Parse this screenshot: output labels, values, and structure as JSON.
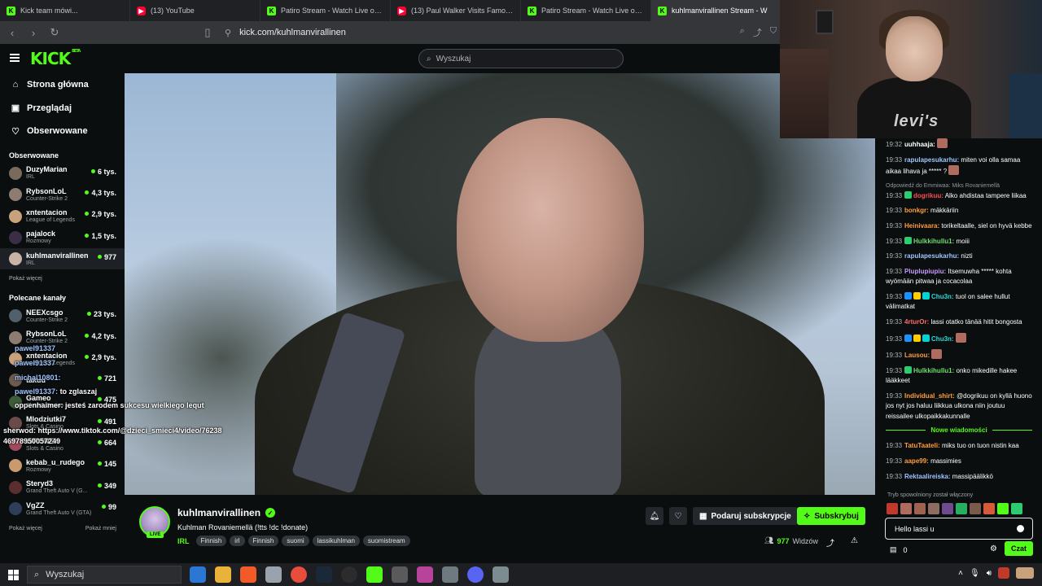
{
  "tabs": [
    {
      "icon": "kick-favicon",
      "fav": "K",
      "label": "Kick team mówi..."
    },
    {
      "icon": "youtube-favicon",
      "fav": "▶",
      "label": "(13) YouTube"
    },
    {
      "icon": "kick-favicon",
      "fav": "K",
      "label": "Patiro Stream - Watch Live on Kick"
    },
    {
      "icon": "youtube-favicon",
      "fav": "▶",
      "label": "(13) Paul Walker Visits Famous Nissan"
    },
    {
      "icon": "kick-favicon",
      "fav": "K",
      "label": "Patiro Stream - Watch Live on Kick"
    },
    {
      "icon": "kick-favicon",
      "fav": "K",
      "label": "kuhlmanvirallinen Stream - W"
    }
  ],
  "address": {
    "url": "kick.com/kuhlmanvirallinen"
  },
  "header": {
    "logo": "KICK",
    "beta": "BETA",
    "search_placeholder": "Wyszukaj"
  },
  "sidebar": {
    "nav": [
      {
        "icon": "home-icon",
        "glyph": "⌂",
        "label": "Strona główna"
      },
      {
        "icon": "browse-icon",
        "glyph": "▣",
        "label": "Przeglądaj"
      },
      {
        "icon": "heart-icon",
        "glyph": "♡",
        "label": "Obserwowane"
      }
    ],
    "followed_title": "Obserwowane",
    "followed": [
      {
        "name": "DuzyMarian",
        "game": "IRL",
        "viewers": "6 tys.",
        "color": "#7a6a5c"
      },
      {
        "name": "RybsonLoL",
        "game": "Counter-Strike 2",
        "viewers": "4,3 tys.",
        "color": "#8c7d70"
      },
      {
        "name": "xntentacion",
        "game": "League of Legends",
        "viewers": "2,9 tys.",
        "color": "#c7a27a"
      },
      {
        "name": "pajalock",
        "game": "Rozmowy",
        "viewers": "1,5 tys.",
        "color": "#3a2e44"
      },
      {
        "name": "kuhlmanvirallinen",
        "game": "IRL",
        "viewers": "977",
        "color": "#c7b4a6"
      }
    ],
    "followed_more": "Pokaż więcej",
    "recommended_title": "Polecane kanały",
    "recommended": [
      {
        "name": "NEEXcsgo",
        "game": "Counter-Strike 2",
        "viewers": "23 tys.",
        "color": "#51606b"
      },
      {
        "name": "RybsonLoL",
        "game": "Counter-Strike 2",
        "viewers": "4,2 tys.",
        "color": "#8c7d70"
      },
      {
        "name": "xntentacion",
        "game": "League of Legends",
        "viewers": "2,9 tys.",
        "color": "#c7a27a"
      },
      {
        "name": "takuu",
        "game": "",
        "viewers": "721",
        "color": "#6d5a4e"
      },
      {
        "name": "Gameo",
        "game": "Slots & Casino",
        "viewers": "475",
        "color": "#3e5c3a"
      },
      {
        "name": "Mlodziutki7",
        "game": "Slots & Casino",
        "viewers": "491",
        "color": "#6b4a4a"
      },
      {
        "name": "WRONEK",
        "game": "Slots & Casino",
        "viewers": "664",
        "color": "#a04b5b"
      },
      {
        "name": "kebab_u_rudego",
        "game": "Rozmowy",
        "viewers": "145",
        "color": "#c89a6d"
      },
      {
        "name": "Steryd3",
        "game": "Grand Theft Auto V (G...",
        "viewers": "349",
        "color": "#5a2e2e"
      },
      {
        "name": "VgZZ",
        "game": "Grand Theft Auto V (GTA)",
        "viewers": "99",
        "color": "#2e3e5a"
      }
    ],
    "more_label": "Pokaż więcej",
    "less_label": "Pokaż mniej"
  },
  "overlay_chat": [
    {
      "user": "pawel91337",
      "text": ""
    },
    {
      "user": "pawel91337",
      "text": ""
    },
    {
      "user": "michal10801:",
      "text": ""
    },
    {
      "user": "pawel91337:",
      "text": "to zglaszaj"
    },
    {
      "user": "oppenhaimer:",
      "text": "jesteś zarodem sukcesu wielkiego lequt"
    },
    {
      "user": "sherwod:",
      "text": "https://www.tiktok.com/@dzieci_smieci4/video/76238"
    },
    {
      "user": "",
      "text": "46978950057249"
    }
  ],
  "stream": {
    "name": "kuhlmanvirallinen",
    "title": "Kuhlman Rovaniemellä (!tts !dc !donate)",
    "category": "IRL",
    "tags": [
      "Finnish",
      "irl",
      "Finnish",
      "suomi",
      "lassikuhlman",
      "suomistream"
    ],
    "live": "LIVE",
    "gift_label": "Podaruj subskrypcje",
    "subscribe_label": "Subskrybuj",
    "viewers": "977",
    "viewers_label": "Widzów"
  },
  "webcam": {
    "shirt_text": "levi's"
  },
  "chat": {
    "messages": [
      {
        "time": "19:32",
        "user": "uuhhaaja:",
        "color": "#ffffff",
        "text": "",
        "emote": true
      },
      {
        "time": "19:33",
        "user": "rapulapesukarhu:",
        "color": "#9ec5ff",
        "text": "miten voi olla samaa aikaa lihava ja ***** ?",
        "emote": true
      },
      {
        "reply": "Odpowiedź do Emmiwaa: Miks Rovaniemellä",
        "time": "19:33",
        "badge": "#2ecc71",
        "user": "dogrikuu:",
        "color": "#ff4d4d",
        "text": "Alko ahdistaa tampere liikaa"
      },
      {
        "time": "19:33",
        "user": "bonkgr:",
        "color": "#ff9e3d",
        "text": "mäkkäriin"
      },
      {
        "time": "19:33",
        "user": "Heinivaara:",
        "color": "#ff9e3d",
        "text": "torikeltaalle, siel on hyvä kebbe"
      },
      {
        "time": "19:33",
        "badge": "#2ecc71",
        "user": "Hulkkihullu1:",
        "color": "#6ddc6d",
        "text": "moiii"
      },
      {
        "time": "19:33",
        "user": "rapulapesukarhu:",
        "color": "#9ec5ff",
        "text": "nizti"
      },
      {
        "time": "19:33",
        "user": "Pluplupiupiu:",
        "color": "#c79cff",
        "text": "Itsemuwha ***** kohta wyömään pitwaa ja cocacolaa"
      },
      {
        "time": "19:33",
        "badges": [
          "#1e90ff",
          "#ffcc00",
          "#00d4d4"
        ],
        "user": "Chu3n:",
        "color": "#2bd9d9",
        "text": "tuol on salee hullut välimatkat"
      },
      {
        "time": "19:33",
        "user": "4rturOr:",
        "color": "#ff6b6b",
        "text": "lassi otatko tänää hitit bongosta"
      },
      {
        "time": "19:33",
        "badges": [
          "#1e90ff",
          "#ffcc00",
          "#00d4d4"
        ],
        "user": "Chu3n:",
        "color": "#2bd9d9",
        "text": "",
        "emote": true
      },
      {
        "time": "19:33",
        "user": "Lausou:",
        "color": "#ff9e3d",
        "text": "",
        "emote": true
      },
      {
        "time": "19:33",
        "badge": "#2ecc71",
        "user": "Hulkkihullu1:",
        "color": "#6ddc6d",
        "text": "onko mikedille hakee lääkkeet"
      },
      {
        "time": "19:33",
        "user": "Individual_shirt:",
        "color": "#ff9e3d",
        "text": "@dogrikuu on kyllä huono jos nyt jos haluu liikkua ulkona niin joutuu reissailee ulkopaikkakunnalle"
      }
    ],
    "new_messages": "Nowe wiadomości",
    "after": [
      {
        "time": "19:33",
        "user": "TatuTaateli:",
        "color": "#ff9e3d",
        "text": "miks tuo on tuon nistin kaa"
      },
      {
        "time": "19:33",
        "user": "aape99:",
        "color": "#ff9e3d",
        "text": "massimies"
      },
      {
        "time": "19:33",
        "user": "Rektaalireiska:",
        "color": "#9ec5ff",
        "text": "massipäälikkö"
      }
    ],
    "slow_mode": "Tryb spowolniony został włączony",
    "input_value": "Hello lassi u",
    "count": "0",
    "send_label": "Czat"
  },
  "taskbar": {
    "search_label": "Wyszukaj"
  }
}
